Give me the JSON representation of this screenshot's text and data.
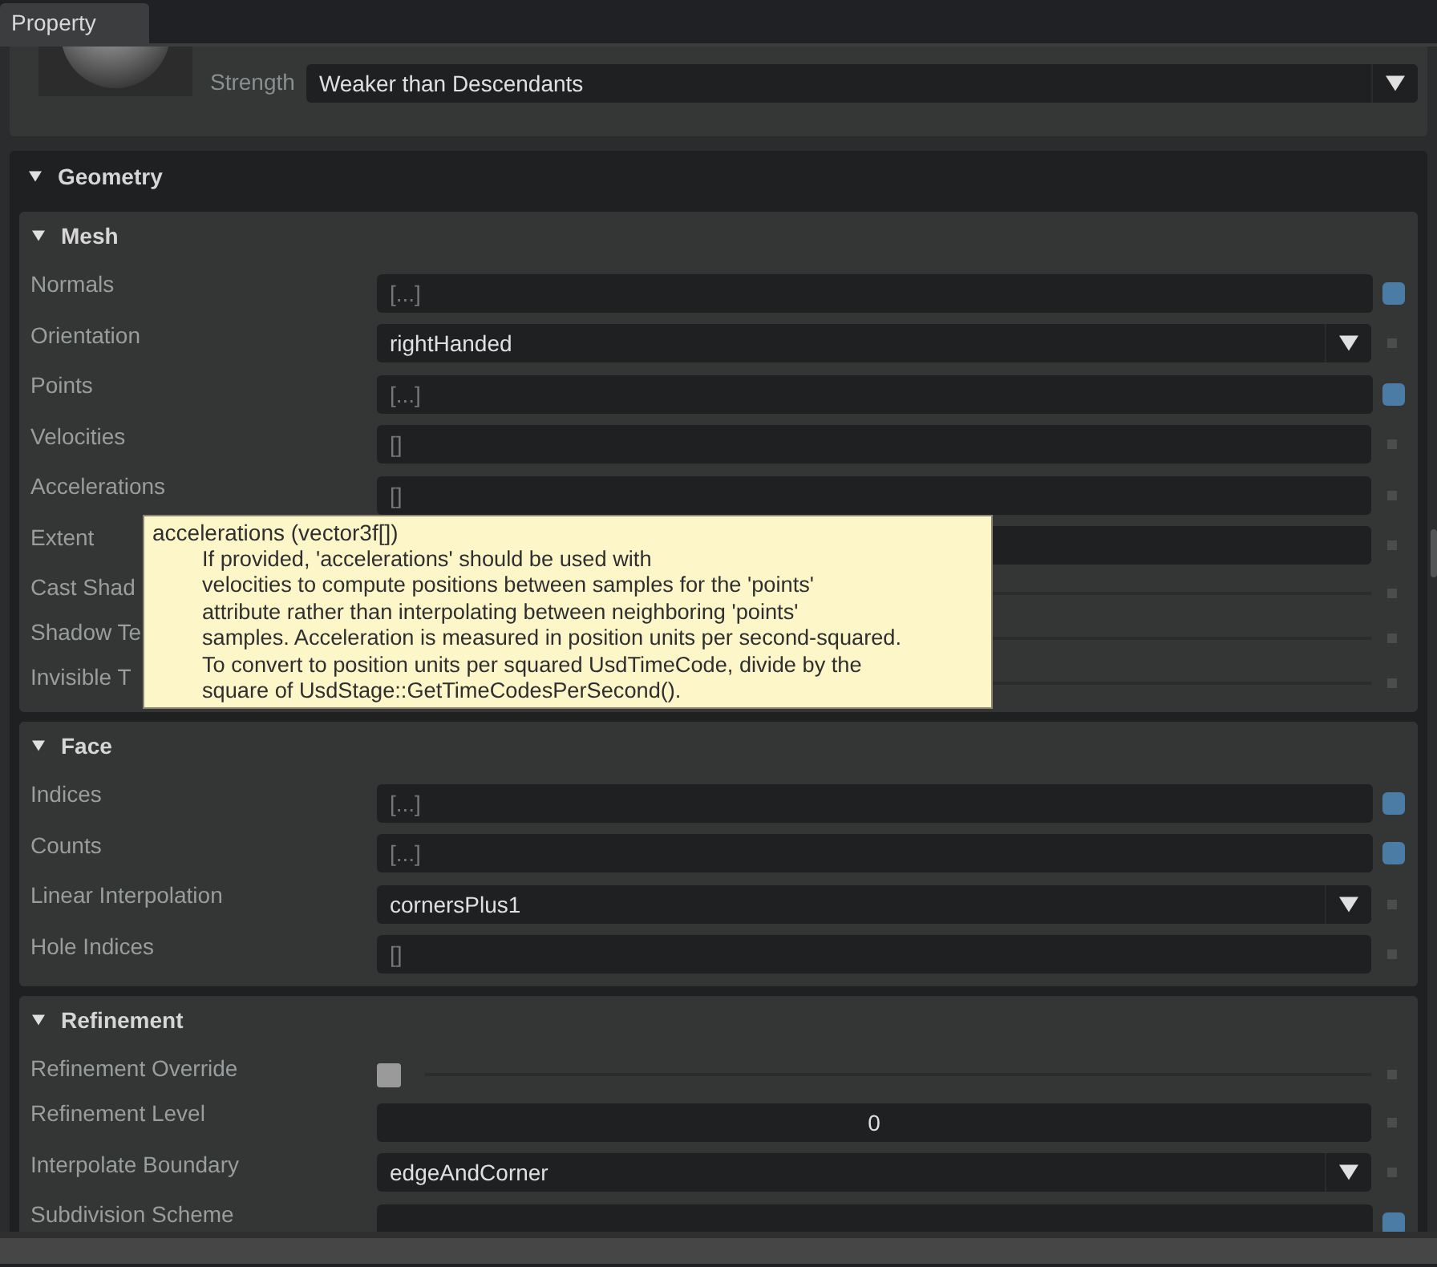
{
  "tab": {
    "label": "Property",
    "selected": true
  },
  "material": {
    "label": "Strength",
    "value": "Weaker than Descendants"
  },
  "section": {
    "title": "Geometry",
    "expanded": true,
    "groups": [
      {
        "title": "Mesh",
        "expanded": true,
        "rows": [
          {
            "kind": "array",
            "label": "Normals",
            "value": "[...]",
            "authored": true
          },
          {
            "kind": "menu",
            "label": "Orientation",
            "value": "rightHanded",
            "authored": false
          },
          {
            "kind": "array",
            "label": "Points",
            "value": "[...]",
            "authored": true
          },
          {
            "kind": "array",
            "label": "Velocities",
            "value": "[]",
            "authored": false
          },
          {
            "kind": "array",
            "label": "Accelerations",
            "value": "[]",
            "authored": false
          },
          {
            "kind": "array",
            "label": "Extent",
            "authored": false
          },
          {
            "kind": "bool",
            "label": "Cast Shad",
            "authored": false
          },
          {
            "kind": "bool",
            "label": "Shadow Te",
            "authored": false
          },
          {
            "kind": "bool",
            "label": "Invisible T",
            "authored": false
          }
        ]
      },
      {
        "title": "Face",
        "expanded": true,
        "rows": [
          {
            "kind": "array",
            "label": "Indices",
            "value": "[...]",
            "authored": true
          },
          {
            "kind": "array",
            "label": "Counts",
            "value": "[...]",
            "authored": true
          },
          {
            "kind": "menu",
            "label": "Linear Interpolation",
            "value": "cornersPlus1",
            "authored": false
          },
          {
            "kind": "array",
            "label": "Hole Indices",
            "value": "[]",
            "authored": false
          }
        ]
      },
      {
        "title": "Refinement",
        "expanded": true,
        "rows": [
          {
            "kind": "bool",
            "label": "Refinement Override",
            "checked": false,
            "authored": false
          },
          {
            "kind": "number",
            "label": "Refinement Level",
            "value": "0",
            "authored": false
          },
          {
            "kind": "menu",
            "label": "Interpolate Boundary",
            "value": "edgeAndCorner",
            "authored": false
          },
          {
            "kind": "array",
            "label": "Subdivision Scheme",
            "authored": true
          }
        ]
      }
    ]
  },
  "tooltip": {
    "title": "accelerations (vector3f[])",
    "lines": [
      "If provided, 'accelerations' should be used with",
      "velocities to compute positions between samples for the 'points'",
      "attribute rather than interpolating between neighboring 'points'",
      "samples. Acceleration is measured in position units per second-squared.",
      "To convert to position units per squared UsdTimeCode, divide by the",
      "square of UsdStage::GetTimeCodesPerSecond()."
    ]
  }
}
